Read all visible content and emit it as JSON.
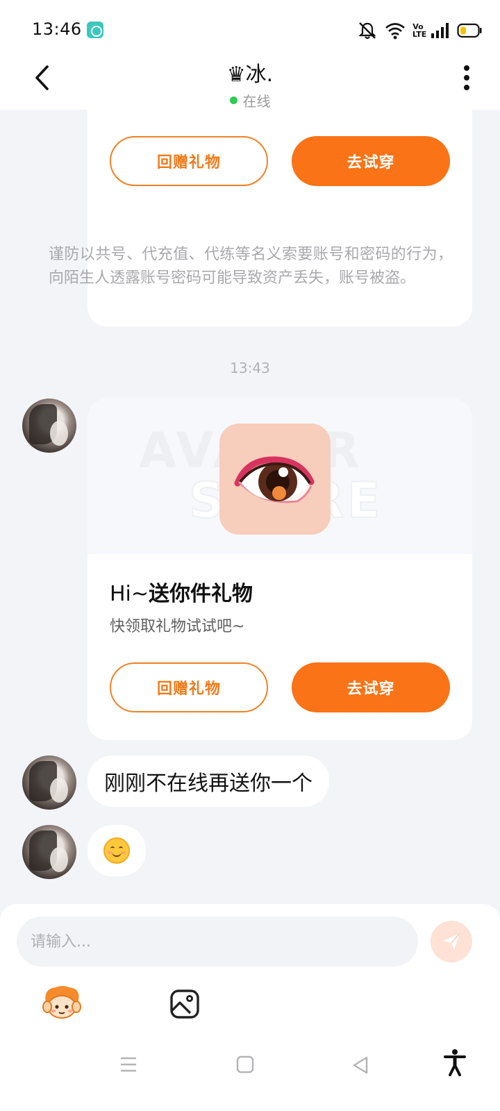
{
  "status_bar": {
    "time": "13:46",
    "app_icon": "notification-app-icon",
    "volte": "Vo LTE",
    "icons": [
      "mute-icon",
      "wifi-icon",
      "signal-icon",
      "battery-icon"
    ]
  },
  "header": {
    "title": "♛冰.",
    "status": "在线",
    "status_color": "#2ecc52",
    "back_icon": "back-arrow-icon",
    "more_icon": "more-vertical-icon"
  },
  "chat": {
    "previous_card": {
      "return_gift_label": "回赠礼物",
      "try_on_label": "去试穿"
    },
    "warning": "谨防以共号、代充值、代练等名义索要账号和密码的行为，向陌生人透露账号密码可能导致资产丢失，账号被盗。",
    "timestamp": "13:43",
    "gift_card": {
      "title_prefix": "Hi~",
      "title": "送你件礼物",
      "subtitle": "快领取礼物试试吧~",
      "return_gift_label": "回赠礼物",
      "try_on_label": "去试穿"
    },
    "messages": [
      {
        "text": "刚刚不在线再送你一个"
      },
      {
        "emoji": "smile-emoji"
      }
    ]
  },
  "input": {
    "placeholder": "请输入...",
    "value": "",
    "send_icon": "send-icon"
  },
  "tools": [
    "mascot-sticker-icon",
    "image-icon"
  ],
  "nav_bar": [
    "menu-icon",
    "home-icon",
    "back-icon",
    "accessibility-icon"
  ],
  "colors": {
    "accent": "#fa7316",
    "background": "#f3f4f8"
  }
}
